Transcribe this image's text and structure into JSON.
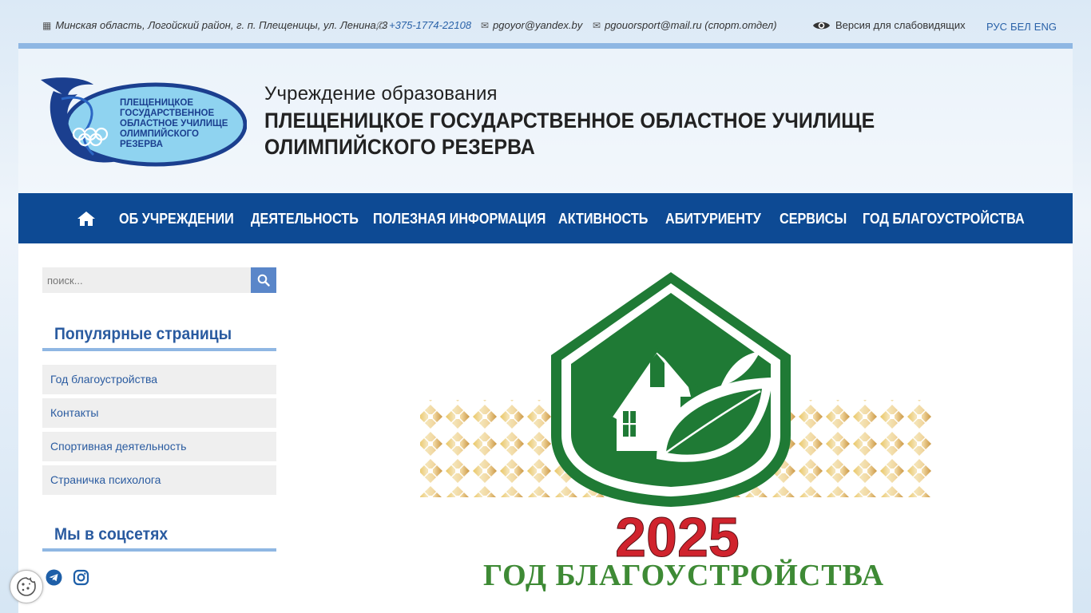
{
  "topbar": {
    "address": "Минская область, Логойский район, г. п. Плещеницы, ул. Ленина, 3",
    "phone": "+375-1774-22108",
    "email1": "pgoyor@yandex.by",
    "email2": "pgouorsport@mail.ru (спорт.отдел)",
    "accessibility": "Версия для слабовидящих",
    "langs": [
      "РУС",
      "БЕЛ",
      "ENG"
    ]
  },
  "header": {
    "subtitle": "Учреждение образования",
    "title": "ПЛЕЩЕНИЦКОЕ ГОСУДАРСТВЕННОЕ ОБЛАСТНОЕ УЧИЛИЩЕ ОЛИМПИЙСКОГО РЕЗЕРВА",
    "logo_text": [
      "ПЛЕЩЕНИЦКОЕ",
      "ГОСУДАРСТВЕННОЕ",
      "ОБЛАСТНОЕ УЧИЛИЩЕ",
      "ОЛИМПИЙСКОГО",
      "РЕЗЕРВА"
    ]
  },
  "nav": {
    "items": [
      "ОБ УЧРЕЖДЕНИИ",
      "ДЕЯТЕЛЬНОСТЬ",
      "ПОЛЕЗНАЯ ИНФОРМАЦИЯ",
      "АКТИВНОСТЬ",
      "АБИТУРИЕНТУ",
      "СЕРВИСЫ",
      "ГОД БЛАГОУСТРОЙСТВА"
    ]
  },
  "sidebar": {
    "search_placeholder": "поиск...",
    "popular_title": "Популярные страницы",
    "popular_items": [
      "Год благоустройства",
      "Контакты",
      "Спортивная деятельность",
      "Страничка психолога"
    ],
    "social_title": "Мы в соцсетях"
  },
  "banner": {
    "year": "2025",
    "caption": "ГОД БЛАГОУСТРОЙСТВА"
  },
  "colors": {
    "nav": "#0d4a94",
    "accent_line": "#8fb7e3",
    "link": "#2a5ba0",
    "banner_green": "#1f7a35",
    "banner_red": "#d0232d"
  }
}
